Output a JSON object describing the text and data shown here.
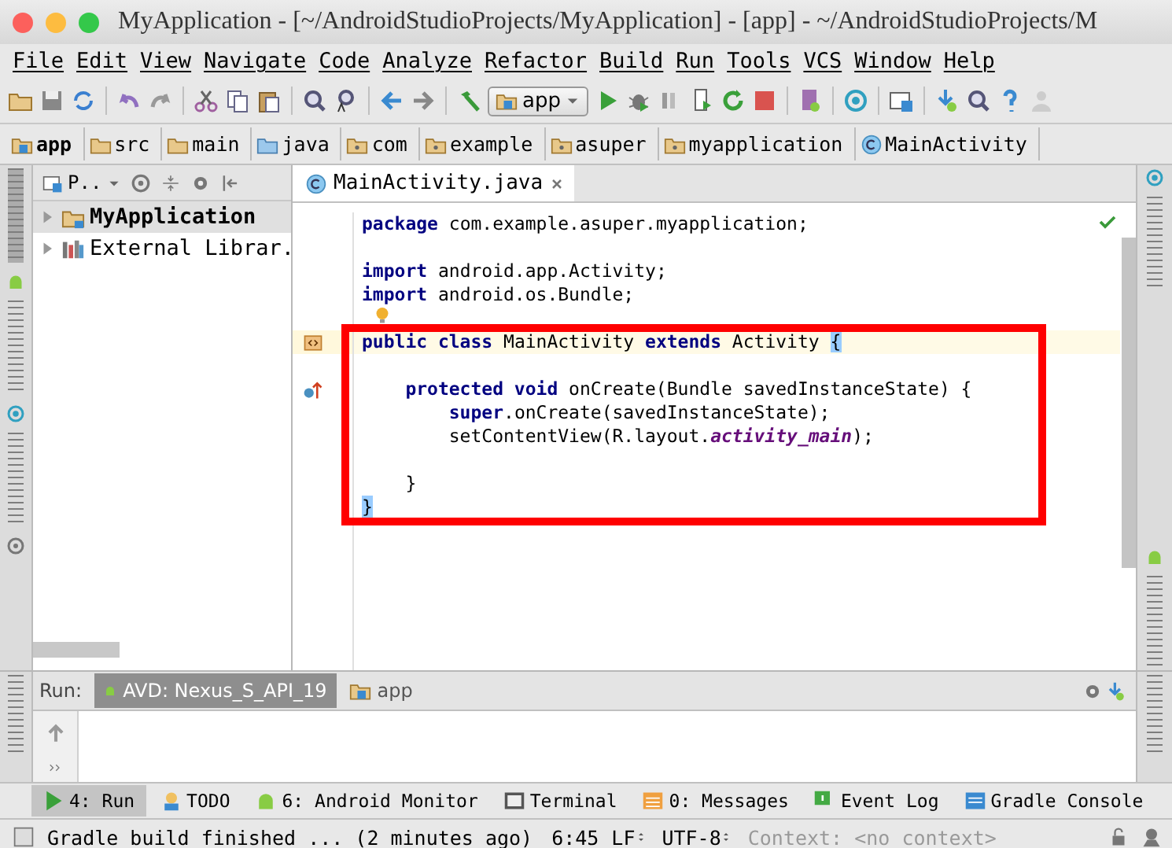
{
  "window": {
    "title": "MyApplication - [~/AndroidStudioProjects/MyApplication] - [app] - ~/AndroidStudioProjects/M"
  },
  "menu": [
    "File",
    "Edit",
    "View",
    "Navigate",
    "Code",
    "Analyze",
    "Refactor",
    "Build",
    "Run",
    "Tools",
    "VCS",
    "Window",
    "Help"
  ],
  "toolbar": {
    "run_config": "app"
  },
  "breadcrumbs": [
    {
      "label": "app",
      "kind": "module"
    },
    {
      "label": "src",
      "kind": "folder"
    },
    {
      "label": "main",
      "kind": "folder"
    },
    {
      "label": "java",
      "kind": "source"
    },
    {
      "label": "com",
      "kind": "package"
    },
    {
      "label": "example",
      "kind": "package"
    },
    {
      "label": "asuper",
      "kind": "package"
    },
    {
      "label": "myapplication",
      "kind": "package"
    },
    {
      "label": "MainActivity",
      "kind": "class"
    }
  ],
  "project": {
    "view_label": "P..",
    "tree": [
      {
        "label": "MyApplication",
        "kind": "project",
        "selected": true,
        "expanded": false
      },
      {
        "label": "External Librar.",
        "kind": "libraries",
        "selected": false,
        "expanded": false
      }
    ]
  },
  "editor": {
    "tabs": [
      {
        "label": "MainActivity.java",
        "selected": true
      }
    ],
    "lines": [
      {
        "kind": "code",
        "tokens": [
          {
            "kind": "keyword",
            "text": "package"
          },
          {
            "kind": "plain",
            "text": " com.example.asuper.myapplication;"
          }
        ]
      },
      {
        "kind": "blank"
      },
      {
        "kind": "code",
        "tokens": [
          {
            "kind": "keyword",
            "text": "import"
          },
          {
            "kind": "plain",
            "text": " android.app.Activity;"
          }
        ]
      },
      {
        "kind": "code",
        "tokens": [
          {
            "kind": "keyword",
            "text": "import"
          },
          {
            "kind": "plain",
            "text": " android.os.Bundle;"
          }
        ]
      },
      {
        "kind": "blank"
      },
      {
        "kind": "class",
        "current": true,
        "tokens": [
          {
            "kind": "keyword",
            "text": "public class"
          },
          {
            "kind": "plain",
            "text": " MainActivity "
          },
          {
            "kind": "keyword",
            "text": "extends"
          },
          {
            "kind": "plain",
            "text": " Activity "
          },
          {
            "kind": "brace",
            "text": "{"
          }
        ]
      },
      {
        "kind": "blank"
      },
      {
        "kind": "override",
        "tokens": [
          {
            "kind": "keyword",
            "text": "    protected void"
          },
          {
            "kind": "plain",
            "text": " onCreate(Bundle savedInstanceState) {"
          }
        ]
      },
      {
        "kind": "code",
        "tokens": [
          {
            "kind": "keyword",
            "text": "        super"
          },
          {
            "kind": "plain",
            "text": ".onCreate(savedInstanceState);"
          }
        ]
      },
      {
        "kind": "code",
        "tokens": [
          {
            "kind": "plain",
            "text": "        setContentView(R.layout."
          },
          {
            "kind": "field",
            "text": "activity_main"
          },
          {
            "kind": "plain",
            "text": ");"
          }
        ]
      },
      {
        "kind": "blank"
      },
      {
        "kind": "code",
        "tokens": [
          {
            "kind": "plain",
            "text": "    }"
          }
        ]
      },
      {
        "kind": "code",
        "tokens": [
          {
            "kind": "brace",
            "text": "}"
          }
        ]
      }
    ]
  },
  "run_panel": {
    "label": "Run:",
    "tabs": [
      {
        "label": "AVD: Nexus_S_API_19",
        "selected": true
      },
      {
        "label": "app",
        "selected": false
      }
    ]
  },
  "tool_buttons": [
    {
      "label": "4: Run",
      "kind": "run",
      "selected": true
    },
    {
      "label": "TODO",
      "kind": "todo",
      "selected": false
    },
    {
      "label": "6: Android Monitor",
      "kind": "android",
      "selected": false
    },
    {
      "label": "Terminal",
      "kind": "terminal",
      "selected": false
    },
    {
      "label": "0: Messages",
      "kind": "messages",
      "selected": false
    },
    {
      "label": "Event Log",
      "kind": "log",
      "selected": false
    },
    {
      "label": "Gradle Console",
      "kind": "console",
      "selected": false
    }
  ],
  "status_bar": {
    "message": "Gradle build finished ... (2 minutes ago)",
    "position": "6:45",
    "line_separator": "LF",
    "encoding": "UTF-8",
    "context": "Context: <no context>"
  }
}
